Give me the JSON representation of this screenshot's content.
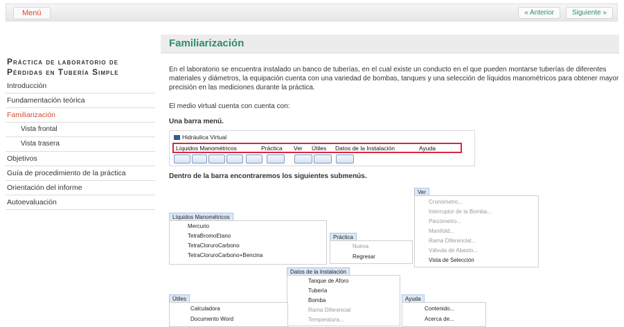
{
  "topbar": {
    "menu_label": "Menú",
    "prev_label": "« Anterior",
    "next_label": "Siguiente »"
  },
  "sidebar": {
    "title": "Práctica de laboratorio de Pérdidas en Tubería Simple",
    "items": [
      {
        "label": "Introducción"
      },
      {
        "label": "Fundamentación teórica"
      },
      {
        "label": "Familiarización"
      },
      {
        "label": "Vista frontal"
      },
      {
        "label": "Vista trasera"
      },
      {
        "label": "Objetivos"
      },
      {
        "label": "Guía de procedimiento de la práctica"
      },
      {
        "label": "Orientación del informe"
      },
      {
        "label": "Autoevaluación"
      }
    ]
  },
  "main": {
    "title": "Familiarización",
    "paragraph1": "En el laboratorio se encuentra instalado un banco de tuberías, en el cual existe un conducto en el que pueden montarse tuberías de diferentes materiales y diámetros, la equipación cuenta con una variedad de bombas, tanques y una selección de líquidos manométricos para obtener mayor precisión en las mediciones durante la práctica.",
    "paragraph2": "El medio virtual cuenta con cuenta con:",
    "paragraph3": "Una barra menú.",
    "paragraph4": "Dentro de la barra encontraremos los siguientes submenús."
  },
  "app": {
    "title": "Hidráulica Virtual",
    "menus": [
      "Líquidos Manométricos",
      "Práctica",
      "Ver",
      "Útiles",
      "Datos de la Instalación",
      "Ayuda"
    ]
  },
  "submenus": {
    "liquidos": {
      "title": "Líquidos Manométricos",
      "items": [
        "Mercurio",
        "TetraBromoEtano",
        "TetraCloruroCarbono",
        "TetraCloruroCarbono+Bencina"
      ]
    },
    "practica": {
      "title": "Práctica",
      "items": [
        "Nueva",
        "Regresar"
      ]
    },
    "ver": {
      "title": "Ver",
      "items": [
        "Cronómetro...",
        "Interruptor de la Bomba...",
        "Piezómetro...",
        "Manifold...",
        "Rama Diferencial...",
        "Válvula de Abasto...",
        "Vista de Selección"
      ]
    },
    "datos": {
      "title": "Datos de la Instalación",
      "items": [
        "Tanque de Aforo",
        "Tubería",
        "Bomba",
        "Rama Diferencial",
        "Temperatura..."
      ]
    },
    "utiles": {
      "title": "Útiles",
      "items": [
        "Calculadora",
        "Documento Word"
      ]
    },
    "ayuda": {
      "title": "Ayuda",
      "items": [
        "Contenido...",
        "Acerca de..."
      ]
    }
  }
}
